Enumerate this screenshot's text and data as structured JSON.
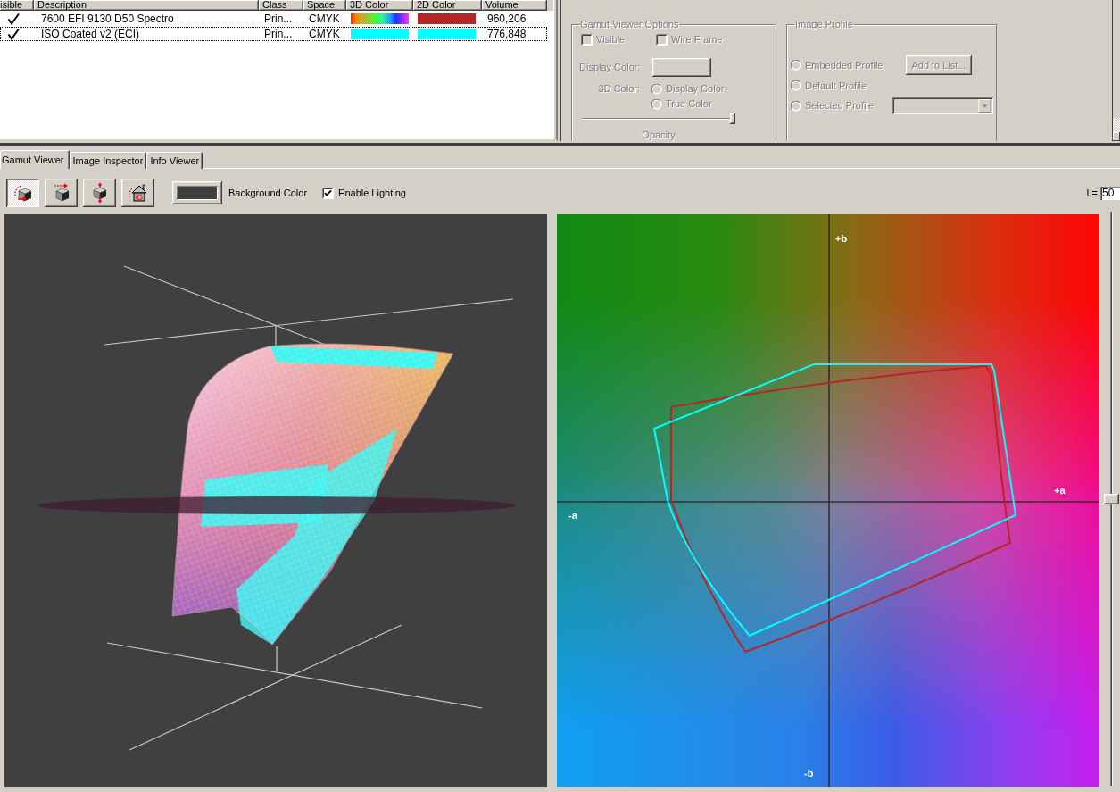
{
  "profiles_table": {
    "columns": [
      "isible",
      "Description",
      "Class",
      "Space",
      "3D Color",
      "2D Color",
      "Volume"
    ],
    "rows": [
      {
        "visible": true,
        "selected": false,
        "description": "7600 EFI 9130 D50 Spectro",
        "class": "Prin...",
        "space": "CMYK",
        "swatch_3d": {
          "kind": "spectrum"
        },
        "swatch_2d": {
          "color": "#b52626"
        },
        "volume": "960,206"
      },
      {
        "visible": true,
        "selected": true,
        "description": "ISO Coated v2 (ECI)",
        "class": "Prin...",
        "space": "CMYK",
        "swatch_3d": {
          "kind": "solid",
          "color": "#00ffff"
        },
        "swatch_2d": {
          "color": "#00ffff"
        },
        "volume": "776,848"
      }
    ]
  },
  "gamut_viewer_options": {
    "title": "Gamut Viewer Options",
    "disabled": true,
    "visible": {
      "label": "Visible",
      "checked": false
    },
    "wire_frame": {
      "label": "Wire Frame",
      "checked": false
    },
    "display_color_label": "Display Color:",
    "color_3d_label": "3D Color:",
    "color_3d_options": [
      {
        "label": "Display Color",
        "selected": false
      },
      {
        "label": "True Color",
        "selected": false
      }
    ],
    "opacity": {
      "label": "Opacity",
      "level": 1
    }
  },
  "image_profile": {
    "title": "Image Profile",
    "disabled": true,
    "options": [
      {
        "label": "Embedded Profile",
        "selected": false
      },
      {
        "label": "Default Profile",
        "selected": false
      },
      {
        "label": "Selected Profile",
        "selected": false
      }
    ],
    "add_button": "Add to List..."
  },
  "tabs": [
    {
      "label": "Gamut Viewer",
      "selected": true
    },
    {
      "label": "Image Inspector",
      "selected": false
    },
    {
      "label": "Info Viewer",
      "selected": false
    }
  ],
  "toolbar": {
    "view_buttons": [
      {
        "selected": true
      },
      {
        "selected": false
      },
      {
        "selected": false
      },
      {
        "selected": false
      }
    ],
    "background_color": {
      "label": "Background Color",
      "color": "#404040"
    },
    "enable_lighting": {
      "label": "Enable Lighting",
      "checked": true
    },
    "lightness": {
      "label": "L=",
      "value": "50"
    }
  },
  "plane_view": {
    "axis_labels": {
      "plus_b": "+b",
      "minus_b": "-b",
      "plus_a": "+a",
      "minus_a": "-a"
    }
  },
  "lightness_slider": {
    "level": 0.5
  }
}
